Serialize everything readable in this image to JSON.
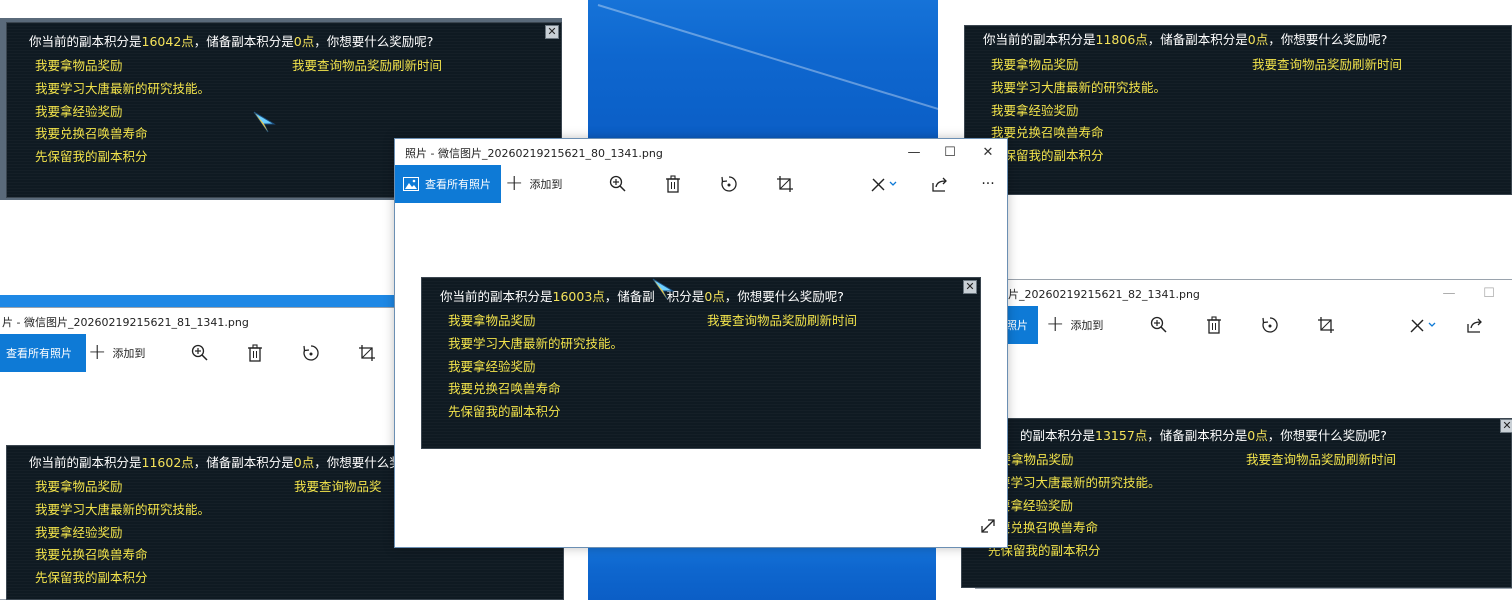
{
  "viewers": {
    "front": {
      "title": "照片 - 微信图片_20260219215621_80_1341.png",
      "view_all_label": "查看所有照片",
      "add_to_label": "添加到",
      "minimize_glyph": "—",
      "maximize_glyph": "☐",
      "close_glyph": "✕",
      "more_glyph": "···"
    },
    "left": {
      "title": "片 - 微信图片_20260219215621_81_1341.png",
      "view_all_label": "查看所有照片",
      "add_to_label": "添加到"
    },
    "right": {
      "title": "片_20260219215621_82_1341.png",
      "view_all_label": "照片",
      "add_to_label": "添加到",
      "minimize_glyph": "—",
      "maximize_glyph": "☐"
    }
  },
  "dialogs": {
    "top_left": {
      "prompt_prefix": "你当前的副本积分是",
      "points": "16042点",
      "prompt_mid": "，储备副本积分是",
      "reserve": "0点",
      "prompt_suffix": "，你想要什么奖励呢?",
      "options": [
        "我要拿物品奖励",
        "我要学习大唐最新的研究技能。",
        "我要拿经验奖励",
        "我要兑换召唤兽寿命",
        "先保留我的副本积分"
      ],
      "option_refresh": "我要查询物品奖励刷新时间",
      "close_glyph": "✕"
    },
    "top_right": {
      "prompt_prefix": "你当前的副本积分是",
      "points": "11806点",
      "prompt_mid": "，储备副本积分是",
      "reserve": "0点",
      "prompt_suffix": "，你想要什么奖励呢?",
      "options": [
        "我要拿物品奖励",
        "我要学习大唐最新的研究技能。",
        "我要拿经验奖励",
        "我要兑换召唤兽寿命",
        "先保留我的副本积分"
      ],
      "option_refresh": "我要查询物品奖励刷新时间"
    },
    "center": {
      "prompt_prefix": "你当前的副本积分是",
      "points": "16003点",
      "prompt_mid_a": "，储备副",
      "prompt_mid_b": "积分是",
      "reserve": "0点",
      "prompt_suffix": "，你想要什么奖励呢?",
      "options": [
        "我要拿物品奖励",
        "我要学习大唐最新的研究技能。",
        "我要拿经验奖励",
        "我要兑换召唤兽寿命",
        "先保留我的副本积分"
      ],
      "option_refresh": "我要查询物品奖励刷新时间",
      "close_glyph": "✕"
    },
    "bottom_left": {
      "prompt_prefix": "你当前的副本积分是",
      "points": "11602点",
      "prompt_mid": "，储备副本积分是",
      "reserve": "0点",
      "prompt_suffix": "，你想要什么奖",
      "options": [
        "我要拿物品奖励",
        "我要学习大唐最新的研究技能。",
        "我要拿经验奖励",
        "我要兑换召唤兽寿命",
        "先保留我的副本积分"
      ],
      "option_refresh": "我要查询物品奖"
    },
    "bottom_right": {
      "prompt_prefix": "的副本积分是",
      "points": "13157点",
      "prompt_mid": "，储备副本积分是",
      "reserve": "0点",
      "prompt_suffix": "，你想要什么奖励呢?",
      "options": [
        "我要拿物品奖励",
        "要学习大唐最新的研究技能。",
        "要拿经验奖励",
        "要兑换召唤兽寿命",
        "先保留我的副本积分"
      ],
      "option_refresh": "我要查询物品奖励刷新时间",
      "close_glyph": "✕"
    }
  },
  "icons": {
    "viewer_toolbar": [
      "gallery-icon",
      "plus-icon",
      "zoom-in-icon",
      "delete-icon",
      "rotate-icon",
      "crop-icon",
      "edit-icon",
      "share-icon",
      "more-icon"
    ],
    "viewer_expand": "expand-icon",
    "game_cursor": "cursor-icon"
  },
  "colors": {
    "accent_blue": "#0e7ad6",
    "wallpaper_blue": "#0e67cf",
    "dialog_bg": "#0f1a22",
    "option_yellow": "#f2e34b",
    "highlight_yellow": "#f5e35a"
  }
}
